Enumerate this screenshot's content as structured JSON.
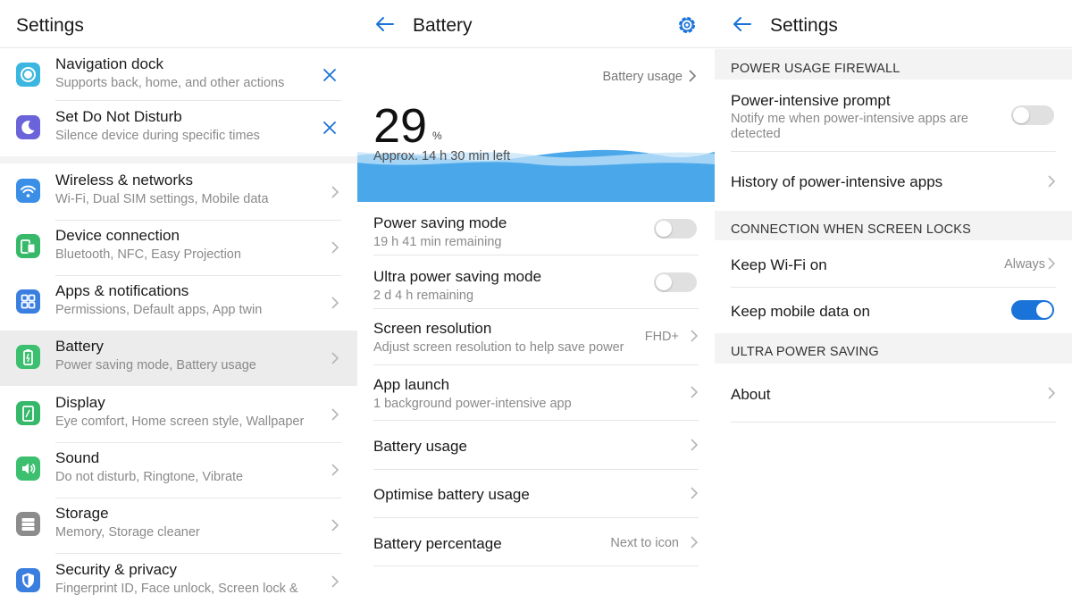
{
  "colors": {
    "accent": "#1a73d9",
    "wave": "#4aa8ea"
  },
  "settings_panel": {
    "title": "Settings",
    "items": [
      {
        "title": "Navigation dock",
        "subtitle": "Supports back, home, and other actions",
        "icon": "navigation-dock-icon",
        "action": "close-icon"
      },
      {
        "title": "Set Do Not Disturb",
        "subtitle": "Silence device during specific times",
        "icon": "moon-icon",
        "action": "close-icon"
      },
      {
        "title": "Wireless & networks",
        "subtitle": "Wi-Fi, Dual SIM settings, Mobile data",
        "icon": "wifi-icon"
      },
      {
        "title": "Device connection",
        "subtitle": "Bluetooth, NFC, Easy Projection",
        "icon": "device-connection-icon"
      },
      {
        "title": "Apps & notifications",
        "subtitle": "Permissions, Default apps, App twin",
        "icon": "apps-grid-icon"
      },
      {
        "title": "Battery",
        "subtitle": "Power saving mode, Battery usage",
        "icon": "battery-icon",
        "selected": true
      },
      {
        "title": "Display",
        "subtitle": "Eye comfort, Home screen style, Wallpaper",
        "icon": "display-icon"
      },
      {
        "title": "Sound",
        "subtitle": "Do not disturb, Ringtone, Vibrate",
        "icon": "speaker-icon"
      },
      {
        "title": "Storage",
        "subtitle": "Memory, Storage cleaner",
        "icon": "storage-icon"
      },
      {
        "title": "Security & privacy",
        "subtitle": "Fingerprint ID, Face unlock, Screen lock &",
        "icon": "shield-icon"
      }
    ]
  },
  "battery_panel": {
    "title": "Battery",
    "usage_link": "Battery usage",
    "level": "29",
    "level_unit": "%",
    "time_left": "Approx. 14 h 30 min left",
    "rows": [
      {
        "title": "Power saving mode",
        "subtitle": "19 h 41 min remaining",
        "toggle": false
      },
      {
        "title": "Ultra power saving mode",
        "subtitle": "2 d 4 h remaining",
        "toggle": false
      },
      {
        "title": "Screen resolution",
        "subtitle": "Adjust screen resolution to help save power",
        "value": "FHD+"
      },
      {
        "title": "App launch",
        "subtitle": "1 background power-intensive app"
      },
      {
        "title": "Battery usage"
      },
      {
        "title": "Optimise battery usage"
      },
      {
        "title": "Battery percentage",
        "value": "Next to icon"
      }
    ]
  },
  "power_panel": {
    "title": "Settings",
    "sections": [
      {
        "header": "POWER USAGE FIREWALL"
      },
      {
        "header": "CONNECTION WHEN SCREEN LOCKS"
      },
      {
        "header": "ULTRA POWER SAVING"
      }
    ],
    "rows": [
      {
        "title": "Power-intensive prompt",
        "subtitle": "Notify me when power-intensive apps are detected",
        "toggle": false
      },
      {
        "title": "History of power-intensive apps"
      },
      {
        "title": "Keep Wi-Fi on",
        "value": "Always"
      },
      {
        "title": "Keep mobile data on",
        "toggle": true
      },
      {
        "title": "About"
      }
    ]
  }
}
